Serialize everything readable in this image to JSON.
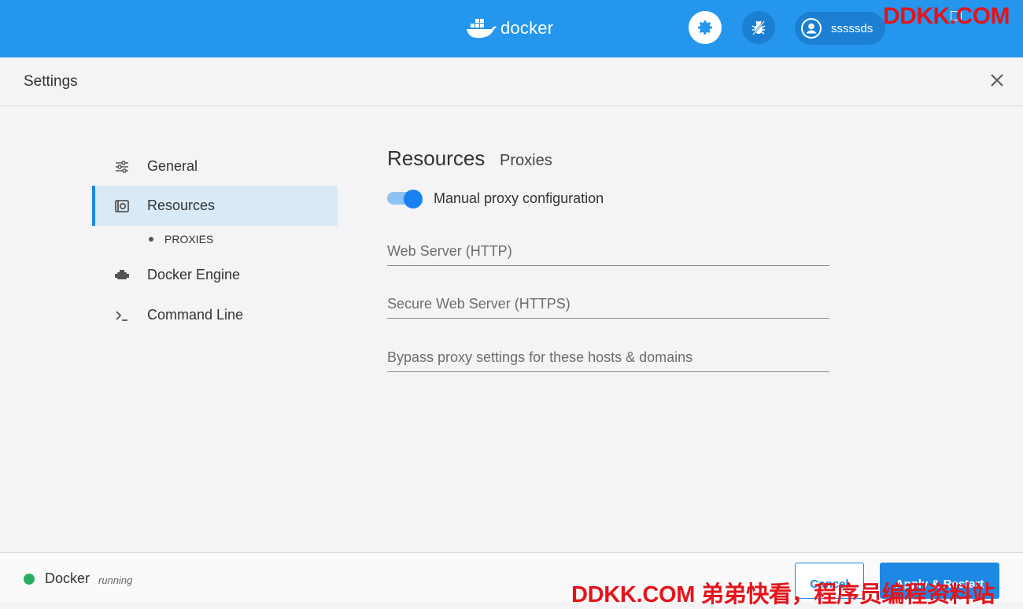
{
  "topbar": {
    "logo_text": "docker",
    "user_name": "sssssds",
    "watermark": "DDKK.COM"
  },
  "header": {
    "title": "Settings"
  },
  "sidebar": {
    "items": [
      {
        "label": "General"
      },
      {
        "label": "Resources"
      },
      {
        "label": "Docker Engine"
      },
      {
        "label": "Command Line"
      }
    ],
    "subitem": "PROXIES"
  },
  "content": {
    "title": "Resources",
    "subtitle": "Proxies",
    "toggle_label": "Manual proxy configuration",
    "toggle_on": true,
    "fields": {
      "http_placeholder": "Web Server (HTTP)",
      "https_placeholder": "Secure Web Server (HTTPS)",
      "bypass_placeholder": "Bypass proxy settings for these hosts & domains"
    }
  },
  "footer": {
    "status_name": "Docker",
    "status_state": "running",
    "cancel_label": "Cancel",
    "apply_label": "Apply & Restart",
    "watermark": "DDKK.COM 弟弟快看，程序员编程资料站"
  },
  "colors": {
    "brand": "#2496ed",
    "accent": "#1e88e5",
    "status_running": "#27ae60",
    "watermark": "#e4141b"
  }
}
